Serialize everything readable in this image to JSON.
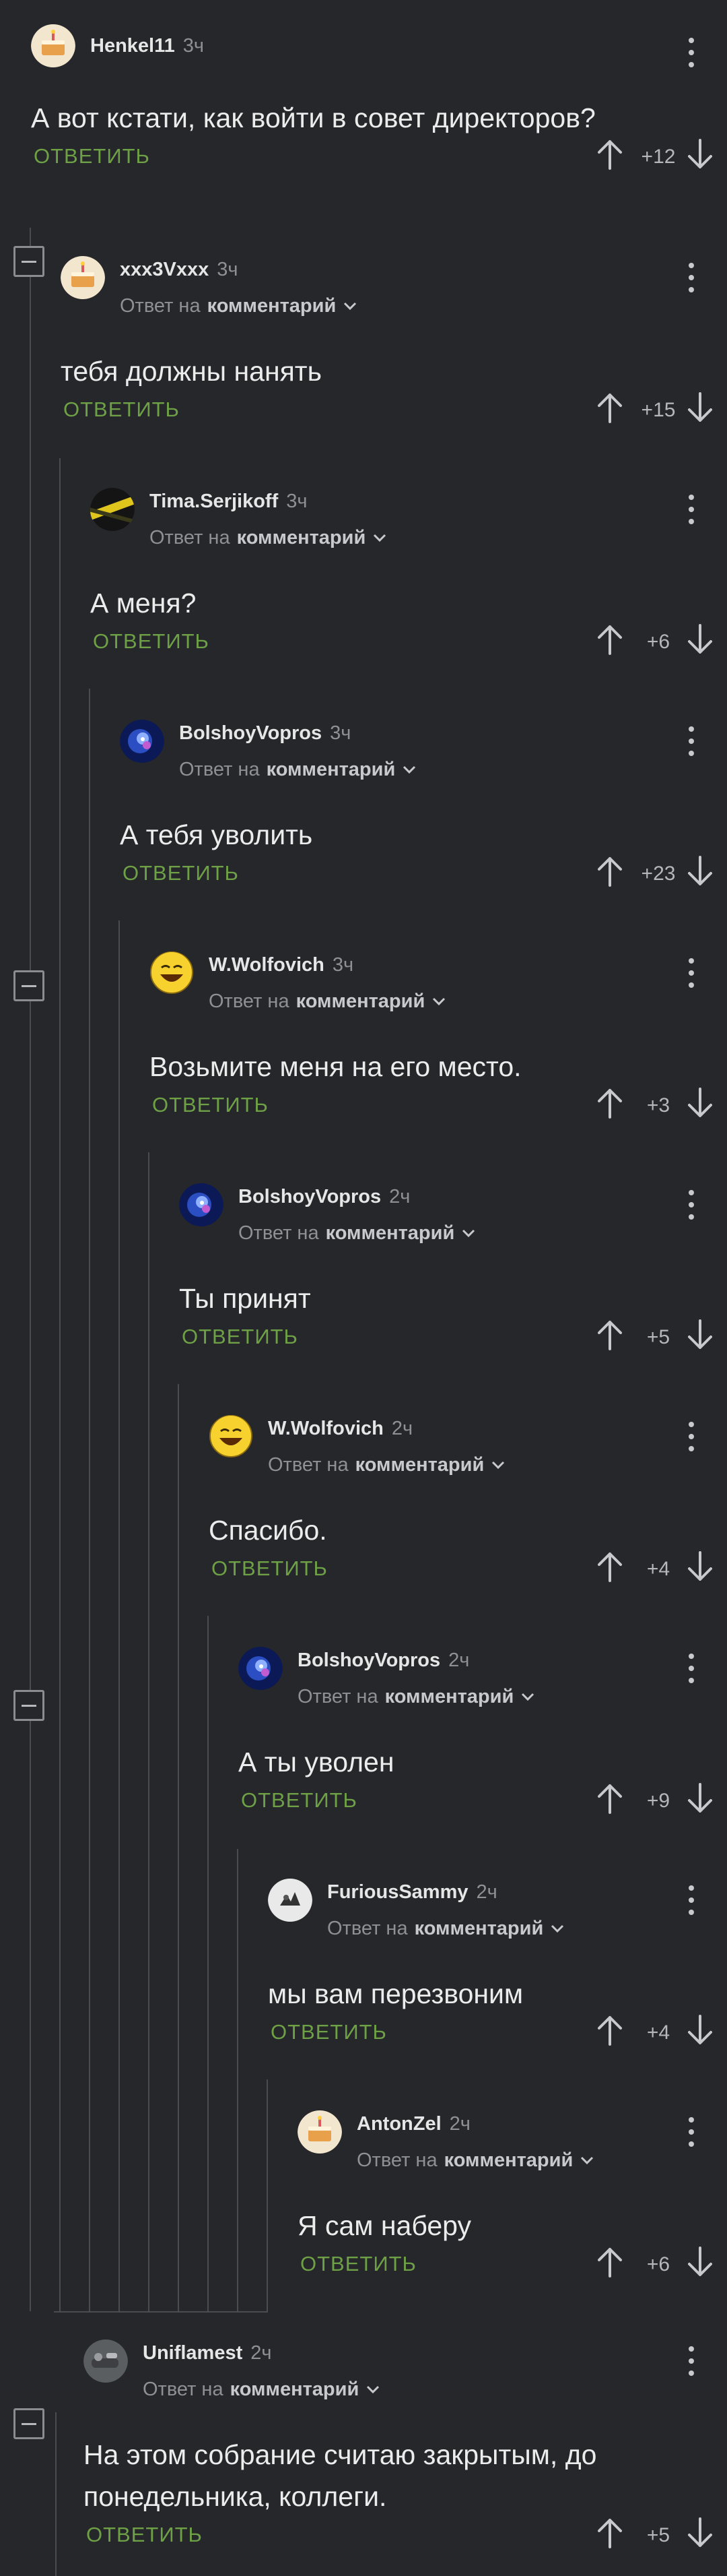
{
  "labels": {
    "reply_prefix": "Ответ на",
    "reply_target": "комментарий",
    "reply_button": "ОТВЕТИТЬ"
  },
  "comments": [
    {
      "author": "Henkel11",
      "time": "3ч",
      "text": "А вот кстати, как войти в совет директоров?",
      "rating": "+12",
      "is_reply": false,
      "avatar": "cake-avatar"
    },
    {
      "author": "xxx3Vxxx",
      "time": "3ч",
      "text": "тебя должны нанять",
      "rating": "+15",
      "is_reply": true,
      "avatar": "cake-avatar"
    },
    {
      "author": "Tima.Serjikoff",
      "time": "3ч",
      "text": "А меня?",
      "rating": "+6",
      "is_reply": true,
      "avatar": "tape-avatar"
    },
    {
      "author": "BolshoyVopros",
      "time": "3ч",
      "text": "А тебя уволить",
      "rating": "+23",
      "is_reply": true,
      "avatar": "nebula-avatar"
    },
    {
      "author": "W.Wolfovich",
      "time": "3ч",
      "text": "Возьмите меня на его место.",
      "rating": "+3",
      "is_reply": true,
      "avatar": "smiley-avatar"
    },
    {
      "author": "BolshoyVopros",
      "time": "2ч",
      "text": "Ты принят",
      "rating": "+5",
      "is_reply": true,
      "avatar": "nebula-avatar"
    },
    {
      "author": "W.Wolfovich",
      "time": "2ч",
      "text": "Спасибо.",
      "rating": "+4",
      "is_reply": true,
      "avatar": "smiley-avatar"
    },
    {
      "author": "BolshoyVopros",
      "time": "2ч",
      "text": "А ты уволен",
      "rating": "+9",
      "is_reply": true,
      "avatar": "nebula-avatar"
    },
    {
      "author": "FuriousSammy",
      "time": "2ч",
      "text": "мы вам перезвоним",
      "rating": "+4",
      "is_reply": true,
      "avatar": "sketch-avatar"
    },
    {
      "author": "AntonZel",
      "time": "2ч",
      "text": "Я сам наберу",
      "rating": "+6",
      "is_reply": true,
      "avatar": "cake-avatar"
    },
    {
      "author": "Uniflamest",
      "time": "2ч",
      "text": "На этом собрание считаю закрытым, до\nпонедельника, коллеги.",
      "rating": "+5",
      "is_reply": true,
      "avatar": "photo-avatar"
    }
  ],
  "colors": {
    "background": "#25272a",
    "reply_green": "#6ea046",
    "muted": "#8e9094",
    "thread_line": "#4a4c50"
  }
}
